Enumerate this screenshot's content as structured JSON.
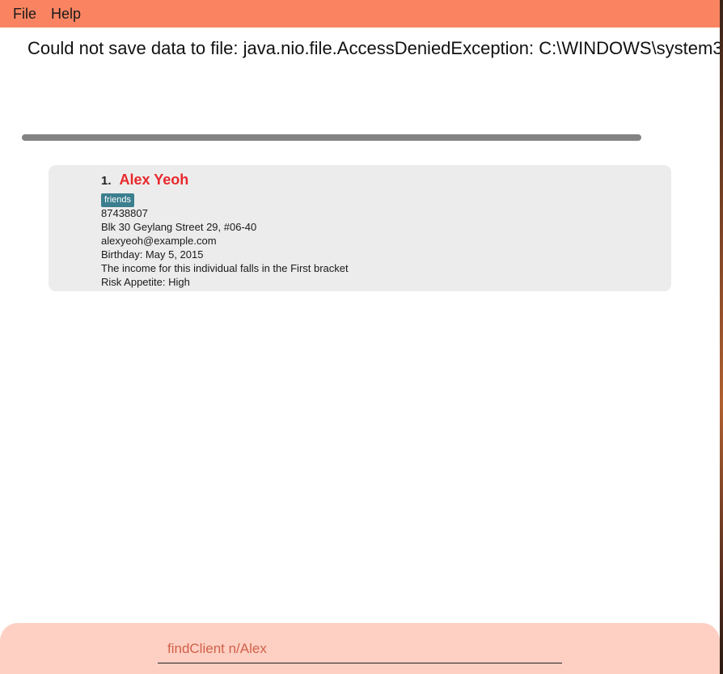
{
  "menubar": {
    "file_label": "File",
    "help_label": "Help"
  },
  "result_display": {
    "text": "Could not save data to file: java.nio.file.AccessDeniedException: C:\\WINDOWS\\system3"
  },
  "person_list": [
    {
      "index": "1.",
      "name": "Alex Yeoh",
      "tags": [
        "friends"
      ],
      "phone": "87438807",
      "address": "Blk 30 Geylang Street 29, #06-40",
      "email": "alexyeoh@example.com",
      "birthday": "Birthday: May 5, 2015",
      "income": "The income for this individual falls in the First bracket",
      "risk_appetite": "Risk Appetite: High"
    }
  ],
  "command_box": {
    "value": "findClient n/Alex"
  },
  "colors": {
    "menubar": "#fa8462",
    "name": "#e8282c",
    "tag": "#3b7e8e",
    "command_box": "#fdd0c3",
    "command_text": "#d2604a"
  }
}
